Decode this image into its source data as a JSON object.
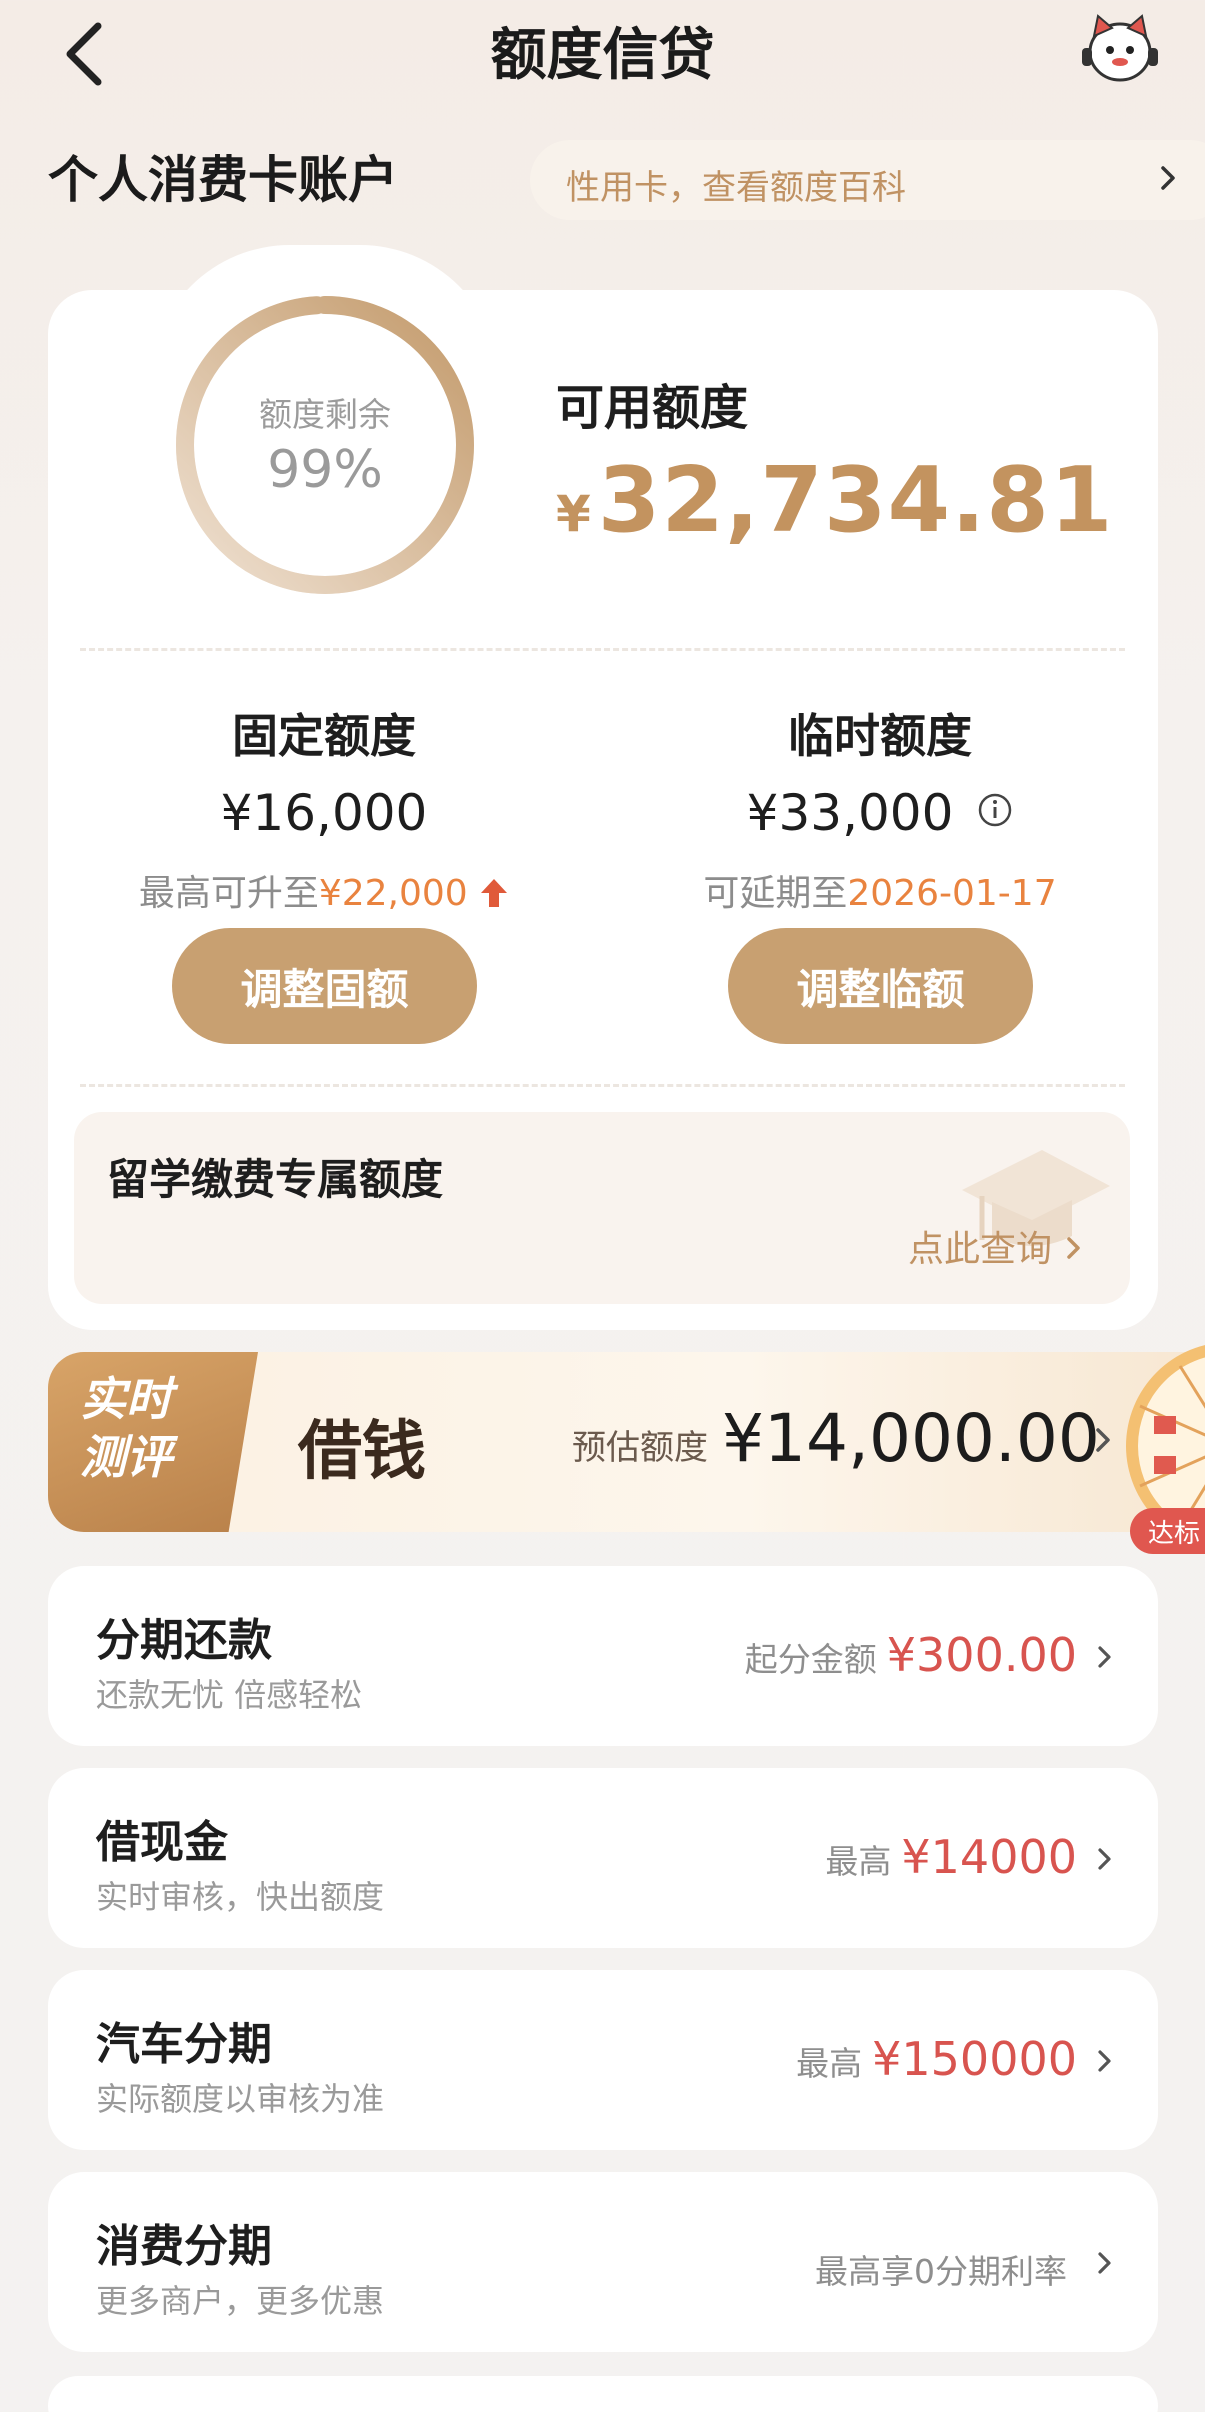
{
  "header": {
    "title": "额度信贷"
  },
  "account": {
    "title": "个人消费卡账户",
    "tip": "性用卡，查看额度百科"
  },
  "credit": {
    "ring_label": "额度剩余",
    "ring_percent_text": "99%",
    "ring_percent": 0.99,
    "available_label": "可用额度",
    "currency_symbol": "¥",
    "available_amount": "32,734.81",
    "fixed": {
      "title": "固定额度",
      "amount": "¥16,000",
      "sub_prefix": "最高可升至",
      "sub_value": "¥22,000",
      "button": "调整固额"
    },
    "temporary": {
      "title": "临时额度",
      "amount": "¥33,000",
      "sub_prefix": "可延期至",
      "sub_value": "2026-01-17",
      "button": "调整临额"
    },
    "study": {
      "title": "留学缴费专属额度",
      "link": "点此查询"
    }
  },
  "borrow_banner": {
    "tag_line1": "实时",
    "tag_line2": "测评",
    "title": "借钱",
    "estimate_label": "预估额度",
    "estimate_amount": "¥14,000.00",
    "badge": "达标"
  },
  "services": [
    {
      "title": "分期还款",
      "subtitle": "还款无忧 倍感轻松",
      "right_label": "起分金额",
      "right_amount": "¥300.00"
    },
    {
      "title": "借现金",
      "subtitle": "实时审核，快出额度",
      "right_label": "最高",
      "right_amount": "¥14000"
    },
    {
      "title": "汽车分期",
      "subtitle": "实际额度以审核为准",
      "right_label": "最高",
      "right_amount": "¥150000"
    },
    {
      "title": "消费分期",
      "subtitle": "更多商户，更多优惠",
      "right_label": "最高享0分期利率",
      "right_amount": ""
    }
  ],
  "colors": {
    "accent_gold": "#c3935f",
    "button_gold": "#c8a071",
    "highlight_orange": "#e9833f",
    "amount_red": "#d8544f"
  },
  "icons": [
    "back-arrow-icon",
    "assistant-avatar-icon",
    "chevron-right-icon",
    "info-icon",
    "up-arrow-icon",
    "graduation-cap-icon",
    "prize-wheel-icon"
  ]
}
